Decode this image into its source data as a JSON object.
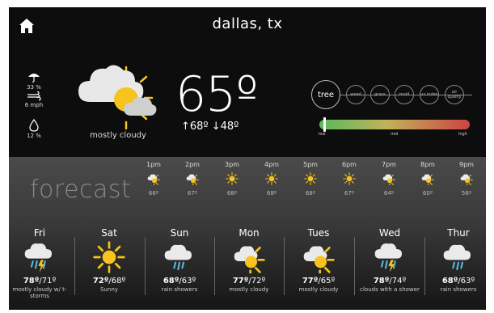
{
  "header": {
    "city": "dallas, tx",
    "home_icon": "home-icon"
  },
  "current": {
    "precip": "33 %",
    "wind": "6 mph",
    "humidity": "12 %",
    "condition": "mostly cloudy",
    "temp": "65º",
    "high": "↑68º",
    "low": "↓48º"
  },
  "pollen": {
    "active": "tree",
    "others": [
      "weed",
      "grass",
      "mold",
      "uv index",
      "air quality"
    ],
    "level_fraction": 0.02,
    "scale": {
      "low": "low",
      "mid": "mid",
      "high": "high"
    },
    "colors": {
      "low": "#5cb85c",
      "mid": "#c1b35a",
      "high": "#cc4444"
    }
  },
  "forecast_label": "forecast",
  "hourly": [
    {
      "time": "1pm",
      "temp": "66º",
      "icon": "partly-cloudy-icon"
    },
    {
      "time": "2pm",
      "temp": "67º",
      "icon": "partly-cloudy-icon"
    },
    {
      "time": "3pm",
      "temp": "68º",
      "icon": "sun-icon"
    },
    {
      "time": "4pm",
      "temp": "68º",
      "icon": "sun-icon"
    },
    {
      "time": "5pm",
      "temp": "68º",
      "icon": "sun-icon"
    },
    {
      "time": "6pm",
      "temp": "67º",
      "icon": "sun-icon"
    },
    {
      "time": "7pm",
      "temp": "64º",
      "icon": "partly-cloudy-icon"
    },
    {
      "time": "8pm",
      "temp": "60º",
      "icon": "partly-cloudy-icon"
    },
    {
      "time": "9pm",
      "temp": "56º",
      "icon": "partly-cloudy-icon"
    }
  ],
  "daily": [
    {
      "day": "Fri",
      "high": "78º",
      "low": "/71º",
      "desc": "mostly cloudy w/ t-storms",
      "icon": "thunderstorm-icon"
    },
    {
      "day": "Sat",
      "high": "72º",
      "low": "/68º",
      "desc": "Sunny",
      "icon": "sun-icon"
    },
    {
      "day": "Sun",
      "high": "68º",
      "low": "/63º",
      "desc": "rain showers",
      "icon": "rain-icon"
    },
    {
      "day": "Mon",
      "high": "77º",
      "low": "/72º",
      "desc": "mostly cloudy",
      "icon": "partly-cloudy-icon"
    },
    {
      "day": "Tues",
      "high": "77º",
      "low": "/65º",
      "desc": "mostly cloudy",
      "icon": "partly-cloudy-icon"
    },
    {
      "day": "Wed",
      "high": "78º",
      "low": "/74º",
      "desc": "clouds with a shower",
      "icon": "thunderstorm-icon"
    },
    {
      "day": "Thur",
      "high": "68º",
      "low": "/63º",
      "desc": "rain showers",
      "icon": "rain-icon"
    }
  ]
}
